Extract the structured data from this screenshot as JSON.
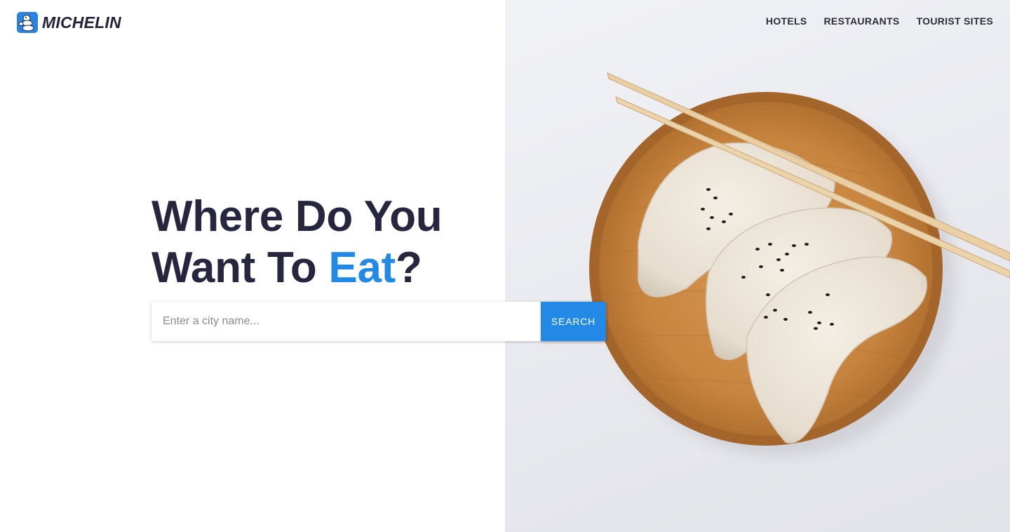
{
  "brand": {
    "name": "MICHELIN",
    "logo_icon": "michelin-man-icon",
    "logo_color": "#2b83df"
  },
  "nav": {
    "items": [
      {
        "label": "HOTELS"
      },
      {
        "label": "RESTAURANTS"
      },
      {
        "label": "TOURIST SITES"
      }
    ]
  },
  "hero": {
    "headline_line1": "Where Do You",
    "headline_line2_prefix": "Want To ",
    "headline_accent": "Eat",
    "headline_suffix": "?",
    "accent_color": "#2289e6",
    "text_color": "#26263f",
    "image_subject": "dumplings-on-wooden-plate-with-chopsticks"
  },
  "search": {
    "placeholder": "Enter a city name...",
    "value": "",
    "button_label": "SEARCH"
  }
}
